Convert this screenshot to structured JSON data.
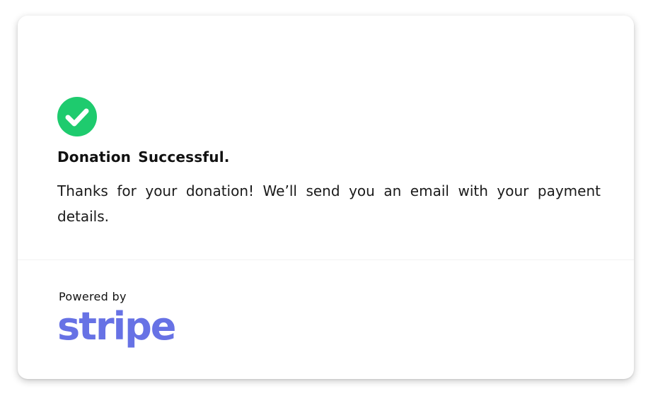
{
  "status": {
    "icon": "check-circle-icon",
    "icon_color": "#1ecb6e",
    "title": "Donation Successful.",
    "message": "Thanks for your donation! We’ll send you an email with your payment details."
  },
  "footer": {
    "powered_label": "Powered by",
    "brand": "stripe",
    "brand_color": "#6772e5"
  }
}
